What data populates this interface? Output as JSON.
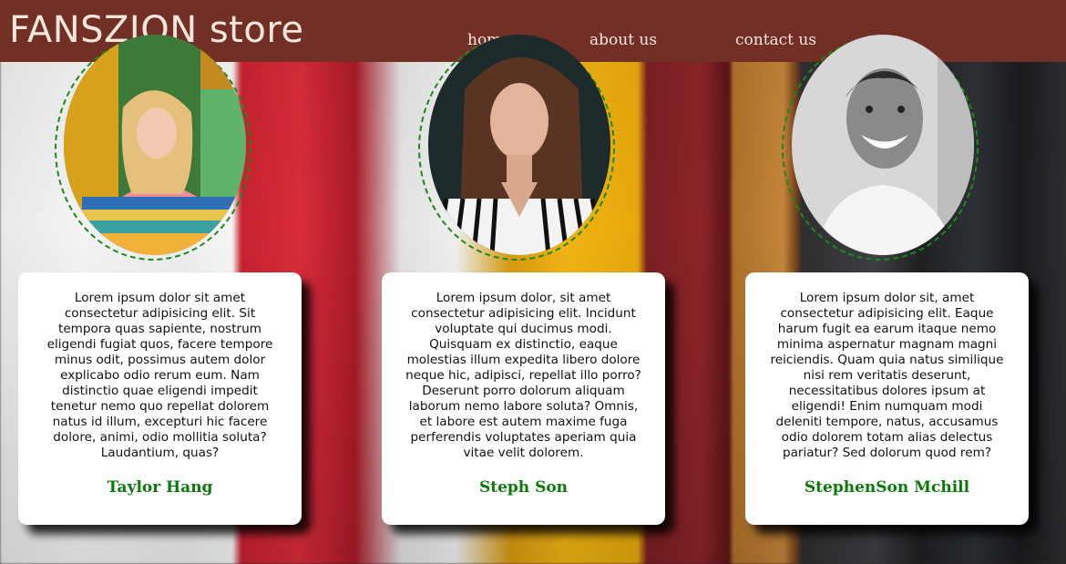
{
  "header": {
    "brand": "FANSZION store",
    "nav": [
      {
        "label": "home"
      },
      {
        "label": "about us"
      },
      {
        "label": "contact us"
      }
    ]
  },
  "testimonials": [
    {
      "text": "Lorem ipsum dolor sit amet consectetur adipisicing elit. Sit tempora quas sapiente, nostrum eligendi fugiat quos, facere tempore minus odit, possimus autem dolor explicabo odio rerum eum. Nam distinctio quae eligendi impedit tenetur nemo quo repellat dolorem natus id illum, excepturi hic facere dolore, animi, odio mollitia soluta? Laudantium, quas?",
      "name": "Taylor Hang"
    },
    {
      "text": "Lorem ipsum dolor, sit amet consectetur adipisicing elit. Incidunt voluptate qui ducimus modi. Quisquam ex distinctio, eaque molestias illum expedita libero dolore neque hic, adipisci, repellat illo porro? Deserunt porro dolorum aliquam laborum nemo labore soluta? Omnis, et labore est autem maxime fuga perferendis voluptates aperiam quia vitae velit dolorem.",
      "name": "Steph Son"
    },
    {
      "text": "Lorem ipsum dolor sit, amet consectetur adipisicing elit. Eaque harum fugit ea earum itaque nemo minima aspernatur magnam magni reiciendis. Quam quia natus similique nisi rem veritatis deserunt, necessitatibus dolores ipsum at eligendi! Enim numquam modi deleniti tempore, natus, accusamus odio dolorem totam alias delectus pariatur? Sed dolorum quod rem?",
      "name": "StephenSon Mchill"
    }
  ],
  "colors": {
    "header_bg": "#722f25",
    "header_text": "#f6e6dc",
    "name_color": "#0b7a0b",
    "ring_color": "#1a8a1a"
  }
}
